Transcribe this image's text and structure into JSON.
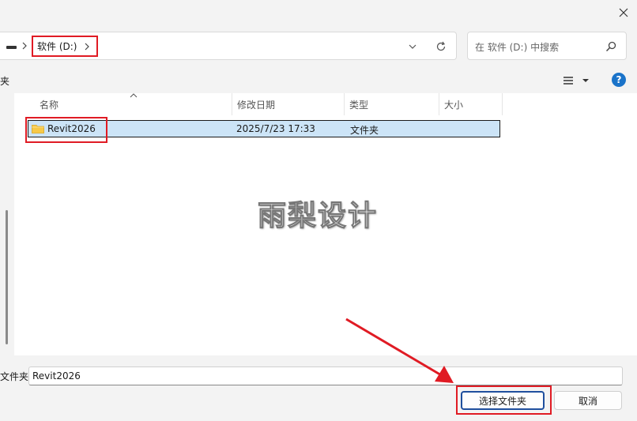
{
  "address": {
    "crumb_label": "软件 (D:)"
  },
  "search": {
    "placeholder": "在 软件 (D:) 中搜索"
  },
  "toolbar": {
    "edge_text": "夹"
  },
  "columns": {
    "name": "名称",
    "modified": "修改日期",
    "type": "类型",
    "size": "大小"
  },
  "files": [
    {
      "name": "Revit2026",
      "modified": "2025/7/23 17:33",
      "type": "文件夹",
      "size": ""
    }
  ],
  "watermark": "雨梨设计",
  "footer": {
    "label": "文件夹:",
    "filename_value": "Revit2026",
    "select_button": "选择文件夹",
    "cancel_button": "取消"
  },
  "colors": {
    "annotation_red": "#e01b24",
    "selection_blue": "#cce4f7",
    "help_blue": "#1a73c9"
  },
  "icons": {
    "close": "close-icon",
    "drive": "drive-icon",
    "refresh": "refresh-icon",
    "search": "search-icon",
    "view": "view-list-icon",
    "help": "help-icon",
    "folder": "folder-icon"
  }
}
